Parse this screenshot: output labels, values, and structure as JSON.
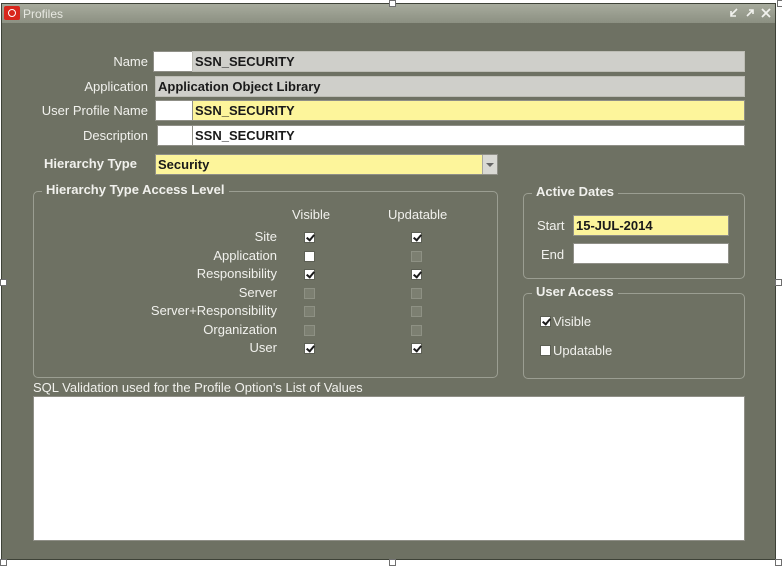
{
  "window": {
    "title": "Profiles"
  },
  "fields": {
    "name": {
      "label": "Name",
      "value": "SSN_SECURITY"
    },
    "application": {
      "label": "Application",
      "value": "Application Object Library"
    },
    "user_profile_name": {
      "label": "User Profile Name",
      "value": "SSN_SECURITY"
    },
    "description": {
      "label": "Description",
      "value": "SSN_SECURITY"
    },
    "hierarchy_type": {
      "label": "Hierarchy Type",
      "value": "Security"
    }
  },
  "access_level": {
    "title": "Hierarchy Type Access Level",
    "col_visible": "Visible",
    "col_updatable": "Updatable",
    "rows": [
      {
        "label": "Site",
        "visible": true,
        "updatable": true,
        "visible_enabled": true,
        "updatable_enabled": true
      },
      {
        "label": "Application",
        "visible": false,
        "updatable": false,
        "visible_enabled": true,
        "updatable_enabled": false
      },
      {
        "label": "Responsibility",
        "visible": true,
        "updatable": true,
        "visible_enabled": true,
        "updatable_enabled": true
      },
      {
        "label": "Server",
        "visible": false,
        "updatable": false,
        "visible_enabled": false,
        "updatable_enabled": false
      },
      {
        "label": "Server+Responsibility",
        "visible": false,
        "updatable": false,
        "visible_enabled": false,
        "updatable_enabled": false
      },
      {
        "label": "Organization",
        "visible": false,
        "updatable": false,
        "visible_enabled": false,
        "updatable_enabled": false
      },
      {
        "label": "User",
        "visible": true,
        "updatable": true,
        "visible_enabled": true,
        "updatable_enabled": true
      }
    ]
  },
  "active_dates": {
    "title": "Active Dates",
    "start_label": "Start",
    "start_value": "15-JUL-2014",
    "end_label": "End",
    "end_value": ""
  },
  "user_access": {
    "title": "User Access",
    "visible_label": "Visible",
    "visible_checked": true,
    "updatable_label": "Updatable",
    "updatable_checked": false
  },
  "sql_validation": {
    "label": "SQL Validation used for the Profile Option's List of Values",
    "value": ""
  },
  "colors": {
    "window_bg": "#6e7163",
    "required_field": "#fdf59b",
    "readonly_field": "#cfcfca",
    "logo_red": "#d8261c"
  }
}
